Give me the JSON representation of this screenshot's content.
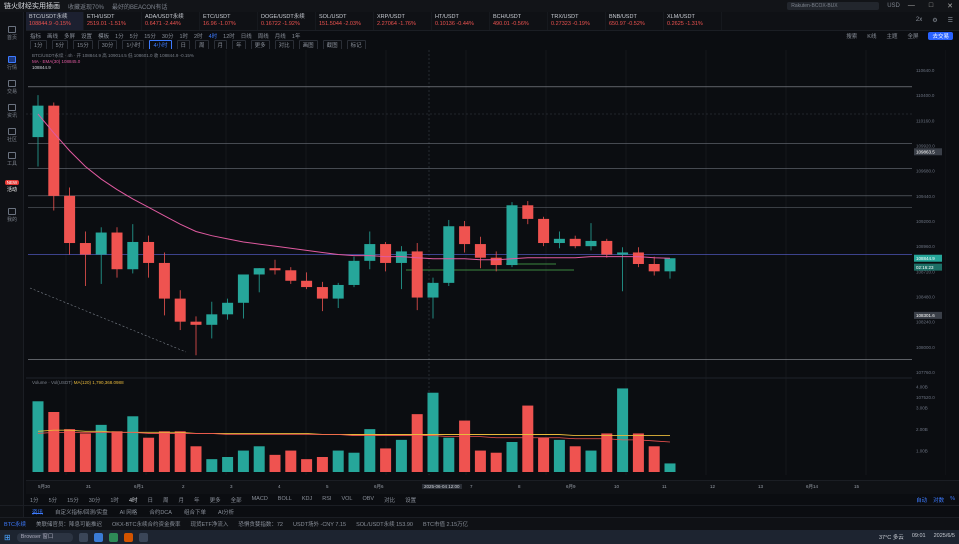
{
  "titlebar": {
    "app_title": "链火财经实用插画",
    "nav1": "收藏返现70%",
    "nav2": "最好的BEACON有话",
    "search_placeholder": "Rakuten-BCOX-BUX",
    "currency": "USD",
    "win_controls": [
      "—",
      "□",
      "✕"
    ]
  },
  "leftbar": {
    "items": [
      "首页",
      "行情",
      "交易",
      "资讯",
      "社区",
      "工具",
      "活动",
      "我的"
    ],
    "badge": "NEW"
  },
  "tickers": [
    {
      "sym": "BTC/USDT永续",
      "price": "108844.9",
      "chg": "-0.15%",
      "dir": "dn",
      "active": true
    },
    {
      "sym": "ETH/USDT",
      "price": "2519.01",
      "chg": "-1.51%",
      "dir": "dn"
    },
    {
      "sym": "ADA/USDT永续",
      "price": "0.6471",
      "chg": "-2.44%",
      "dir": "dn"
    },
    {
      "sym": "ETC/USDT",
      "price": "16.96",
      "chg": "-1.07%",
      "dir": "dn"
    },
    {
      "sym": "DOGE/USDT永续",
      "price": "0.16722",
      "chg": "-1.92%",
      "dir": "dn"
    },
    {
      "sym": "SOL/USDT",
      "price": "151.5044",
      "chg": "-2.03%",
      "dir": "dn"
    },
    {
      "sym": "XRP/USDT",
      "price": "2.27064",
      "chg": "-1.76%",
      "dir": "dn"
    },
    {
      "sym": "HT/USDT",
      "price": "0.10136",
      "chg": "-0.44%",
      "dir": "dn"
    },
    {
      "sym": "BCH/USDT",
      "price": "490.01",
      "chg": "-0.56%",
      "dir": "dn"
    },
    {
      "sym": "TRX/USDT",
      "price": "0.27323",
      "chg": "-0.19%",
      "dir": "dn"
    },
    {
      "sym": "BNB/USDT",
      "price": "650.97",
      "chg": "-0.52%",
      "dir": "dn"
    },
    {
      "sym": "XLM/USDT",
      "price": "0.2625",
      "chg": "-1.31%",
      "dir": "dn"
    }
  ],
  "ticker_menu": [
    "2x",
    "⚙",
    "☰"
  ],
  "toolbar": {
    "items": [
      "指标",
      "画线",
      "多屏",
      "设置",
      "模板",
      "1分",
      "5分",
      "15分",
      "30分",
      "1时",
      "2时",
      "4时",
      "12时",
      "日线",
      "周线",
      "月线",
      "1年"
    ],
    "selected": "4时",
    "right": [
      "搜索",
      "K线",
      "主题",
      "全屏"
    ],
    "trade_btn": "去交易"
  },
  "toolbar2": [
    "1分",
    "5分",
    "15分",
    "30分",
    "1小时",
    "4小时",
    "日",
    "周",
    "月",
    "年",
    "更多",
    "对比",
    "画图",
    "截图",
    "标记"
  ],
  "toolbar2_on": "4小时",
  "legend": {
    "line1": "BTC/USDT永续 · 4h · 开 108844.9 高 109014.5 低 108601.0 收 108844.9 -0.15%",
    "line2": "MA · EMA(30) 108845.0",
    "line3": "108844.9"
  },
  "vol_legend": {
    "label": "Volume · Vol(USDT)",
    "ma": "MA(120) 1,790,368.0988"
  },
  "price_axis": [
    "110640.0",
    "110400.0",
    "110160.0",
    "109920.0",
    "109680.0",
    "109440.0",
    "109200.0",
    "108960.0",
    "108720.0",
    "108480.0",
    "108240.0",
    "108000.0",
    "107760.0",
    "107520.0"
  ],
  "vol_axis": [
    "4.00B",
    "3.00B",
    "2.00B",
    "1.00B"
  ],
  "price_tags": {
    "last": "108844.9",
    "countdown": "02:16:23",
    "hline1": "109863.5",
    "hline2": "108301.6"
  },
  "time_axis": [
    "5月30",
    "31",
    "6月1",
    "2",
    "3",
    "4",
    "5",
    "6月6",
    "2025-06-04 12:00",
    "7",
    "8",
    "6月9",
    "10",
    "11",
    "12",
    "13",
    "6月14",
    "15"
  ],
  "bottom_tabs": [
    "1分",
    "5分",
    "15分",
    "30分",
    "1时",
    "4时",
    "日",
    "周",
    "月",
    "年",
    "更多",
    "全部",
    "MACD",
    "BOLL",
    "KDJ",
    "RSI",
    "VOL",
    "OBV",
    "对比",
    "设置"
  ],
  "bottom_tabs_on": "4时",
  "bottom_right": [
    "自动",
    "对数",
    "%"
  ],
  "panel_tabs": [
    "资讯",
    "自定义指标/回测/实盘",
    "AI 网格",
    "合约DCA",
    "组合下单",
    "AI分析"
  ],
  "panel_tabs_on": "资讯",
  "news": [
    {
      "text": "BTC永续",
      "hl": true
    },
    {
      "text": "美联储官员：降息可能推迟"
    },
    {
      "text": "OKX-BTC永续合约资金费率"
    },
    {
      "text": "现货ETF净流入"
    },
    {
      "text": "恐惧贪婪指数：72"
    },
    {
      "text": "USDT场外 -CNY 7.15"
    },
    {
      "text": "SOL/USDT永续 153.90"
    },
    {
      "text": "BTC市值 2.15万亿"
    }
  ],
  "taskbar": {
    "search": "Browser 窗口",
    "weather": "37°C 多云",
    "time": "09:01",
    "date": "2025/6/5"
  },
  "colors": {
    "up": "#26a69a",
    "down": "#ef5350",
    "accent": "#2962ff",
    "ema": "#e05aa0"
  },
  "chart_data": [
    {
      "type": "candlestick",
      "title": "",
      "candles": [
        {
          "o": 110000,
          "h": 110400,
          "l": 109720,
          "c": 110300
        },
        {
          "o": 110300,
          "h": 110330,
          "l": 109300,
          "c": 109440
        },
        {
          "o": 109440,
          "h": 109520,
          "l": 108880,
          "c": 108990
        },
        {
          "o": 108990,
          "h": 109100,
          "l": 108580,
          "c": 108880
        },
        {
          "o": 108880,
          "h": 109140,
          "l": 108600,
          "c": 109090
        },
        {
          "o": 109090,
          "h": 109140,
          "l": 108660,
          "c": 108740
        },
        {
          "o": 108740,
          "h": 109170,
          "l": 108700,
          "c": 109000
        },
        {
          "o": 109000,
          "h": 109060,
          "l": 108660,
          "c": 108800
        },
        {
          "o": 108800,
          "h": 108900,
          "l": 108300,
          "c": 108460
        },
        {
          "o": 108460,
          "h": 108540,
          "l": 108160,
          "c": 108240
        },
        {
          "o": 108240,
          "h": 108290,
          "l": 107920,
          "c": 108210
        },
        {
          "o": 108210,
          "h": 108430,
          "l": 108080,
          "c": 108310
        },
        {
          "o": 108310,
          "h": 108460,
          "l": 108260,
          "c": 108420
        },
        {
          "o": 108420,
          "h": 108690,
          "l": 108270,
          "c": 108690
        },
        {
          "o": 108690,
          "h": 108750,
          "l": 108520,
          "c": 108750
        },
        {
          "o": 108750,
          "h": 108830,
          "l": 108690,
          "c": 108730
        },
        {
          "o": 108730,
          "h": 108760,
          "l": 108600,
          "c": 108630
        },
        {
          "o": 108630,
          "h": 108710,
          "l": 108550,
          "c": 108570
        },
        {
          "o": 108570,
          "h": 108620,
          "l": 108340,
          "c": 108460
        },
        {
          "o": 108460,
          "h": 108610,
          "l": 108370,
          "c": 108590
        },
        {
          "o": 108590,
          "h": 108860,
          "l": 108570,
          "c": 108820
        },
        {
          "o": 108820,
          "h": 109100,
          "l": 108740,
          "c": 108980
        },
        {
          "o": 108980,
          "h": 109000,
          "l": 108720,
          "c": 108800
        },
        {
          "o": 108800,
          "h": 108960,
          "l": 108550,
          "c": 108910
        },
        {
          "o": 108910,
          "h": 108990,
          "l": 108350,
          "c": 108470
        },
        {
          "o": 108470,
          "h": 108660,
          "l": 108270,
          "c": 108610
        },
        {
          "o": 108610,
          "h": 109210,
          "l": 108580,
          "c": 109150
        },
        {
          "o": 109150,
          "h": 109200,
          "l": 108900,
          "c": 108980
        },
        {
          "o": 108980,
          "h": 109050,
          "l": 108750,
          "c": 108850
        },
        {
          "o": 108850,
          "h": 108910,
          "l": 108720,
          "c": 108780
        },
        {
          "o": 108780,
          "h": 109380,
          "l": 108760,
          "c": 109350
        },
        {
          "o": 109350,
          "h": 109390,
          "l": 109170,
          "c": 109220
        },
        {
          "o": 109220,
          "h": 109240,
          "l": 108960,
          "c": 108990
        },
        {
          "o": 108990,
          "h": 109100,
          "l": 108940,
          "c": 109030
        },
        {
          "o": 109030,
          "h": 109060,
          "l": 108940,
          "c": 108960
        },
        {
          "o": 108960,
          "h": 109180,
          "l": 108920,
          "c": 109010
        },
        {
          "o": 109010,
          "h": 109030,
          "l": 108850,
          "c": 108880
        },
        {
          "o": 108880,
          "h": 108950,
          "l": 108530,
          "c": 108900
        },
        {
          "o": 108900,
          "h": 108950,
          "l": 108760,
          "c": 108790
        },
        {
          "o": 108790,
          "h": 108860,
          "l": 108680,
          "c": 108720
        },
        {
          "o": 108720,
          "h": 108820,
          "l": 108650,
          "c": 108845
        }
      ],
      "ema": [
        110220,
        110040,
        109870,
        109720,
        109600,
        109500,
        109410,
        109330,
        109250,
        109170,
        109100,
        109060,
        109030,
        109000,
        108980,
        108960,
        108940,
        108920,
        108900,
        108880,
        108870,
        108870,
        108860,
        108860,
        108850,
        108840,
        108840,
        108840,
        108830,
        108830,
        108840,
        108850,
        108850,
        108850,
        108850,
        108860,
        108860,
        108860,
        108860,
        108850,
        108845
      ],
      "hlines": [
        110480,
        109940,
        109700,
        109440,
        109330,
        108880,
        107880
      ],
      "ylim": [
        107760,
        110640
      ]
    },
    {
      "type": "bar",
      "title": "Volume",
      "values": [
        3.3,
        2.8,
        2.0,
        1.8,
        2.2,
        1.9,
        2.6,
        1.6,
        1.9,
        1.9,
        1.2,
        0.6,
        0.7,
        1.0,
        1.2,
        0.8,
        1.0,
        0.6,
        0.7,
        1.0,
        0.9,
        2.0,
        1.1,
        1.5,
        2.7,
        3.7,
        1.6,
        2.4,
        1.0,
        0.9,
        1.4,
        3.1,
        1.6,
        1.5,
        1.2,
        1.0,
        1.8,
        3.9,
        1.8,
        1.2,
        0.4
      ],
      "ma": [
        1.9,
        1.95,
        1.95,
        1.9,
        1.9,
        1.85,
        1.85,
        1.85,
        1.85,
        1.85,
        1.8,
        1.8,
        1.8,
        1.8,
        1.8,
        1.8,
        1.8,
        1.8,
        1.75,
        1.75,
        1.75,
        1.75,
        1.75,
        1.75,
        1.75,
        1.75,
        1.75,
        1.75,
        1.75,
        1.75,
        1.75,
        1.75,
        1.75,
        1.75,
        1.7,
        1.7,
        1.7,
        1.7,
        1.7,
        1.7,
        1.7
      ],
      "ma2": [
        1.8,
        1.85,
        1.85,
        1.85,
        1.85,
        1.85,
        1.85,
        1.8,
        1.8,
        1.8,
        1.8,
        1.8,
        1.75,
        1.75,
        1.75,
        1.75,
        1.75,
        1.75,
        1.75,
        1.75,
        1.7,
        1.7,
        1.7,
        1.7,
        1.7,
        1.7,
        1.65,
        1.65,
        1.65,
        1.6,
        1.6,
        1.6,
        1.6,
        1.6,
        1.55,
        1.55,
        1.55,
        1.5,
        1.5,
        1.45,
        1.4
      ],
      "ylim": [
        0,
        4.2
      ]
    }
  ]
}
